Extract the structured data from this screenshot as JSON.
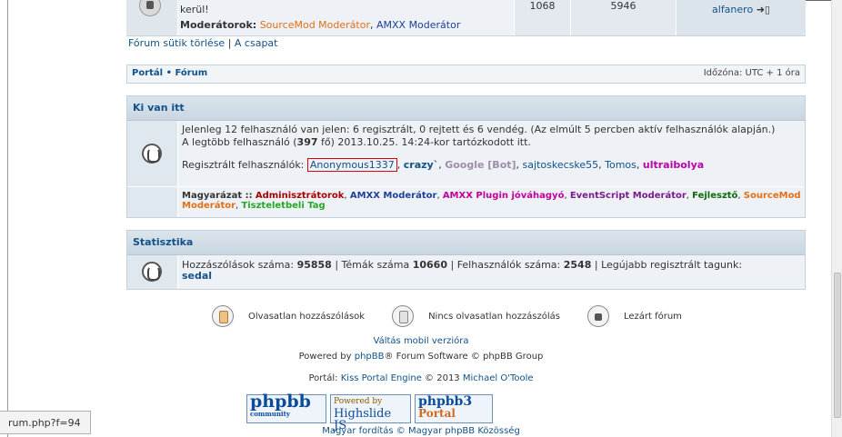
{
  "top_forum_row": {
    "description_tail": "kerül!",
    "moderators_label": "Moderátorok:",
    "moderators": [
      "SourceMod Moderátor",
      "AMXX Moderátor"
    ],
    "topics": "1068",
    "posts": "5946",
    "last_poster": "alfanero"
  },
  "small_links": {
    "delete_cookies": "Fórum sütik törlése",
    "separator": " | ",
    "team": "A csapat"
  },
  "navbar": {
    "portal": "Portál",
    "bullet": " • ",
    "forum": "Fórum",
    "timezone": "Időzóna: UTC + 1 óra"
  },
  "whos_online": {
    "title": "Ki van itt",
    "summary": "Jelenleg 12 felhasználó van jelen: 6 regisztrált, 0 rejtett és 6 vendég. (Az elmúlt 5 percben aktív felhasználók alapján.)",
    "record_prefix": "A legtöbb felhasználó (",
    "record_count": "397",
    "record_suffix": " fő) 2013.10.25. 14:24-kor tartózkodott itt.",
    "registered_label": "Regisztrált felhasználók:",
    "users": [
      "Anonymous1337",
      "crazy`",
      "Google [Bot]",
      "sajtoskecske55",
      "Tomos",
      "ultraibolya"
    ],
    "legend_label": "Magyarázat ::",
    "legend": [
      "Adminisztrátorok",
      "AMXX Moderátor",
      "AMXX Plugin jóváhagyó",
      "EventScript Moderátor",
      "Fejlesztő",
      "SourceMod Moderátor",
      "Tiszteletbeli Tag"
    ]
  },
  "statistics": {
    "title": "Statisztika",
    "posts_label": "Hozzászólások száma:",
    "posts_value": "95858",
    "topics_label": "Témák száma",
    "topics_value": "10660",
    "users_label": "Felhasználók száma:",
    "users_value": "2548",
    "newest_label": "Legújabb regisztrált tagunk:",
    "newest_user": "sedal"
  },
  "legend_icons": {
    "unread": "Olvasatlan hozzászólások",
    "no_unread": "Nincs olvasatlan hozzászólás",
    "locked": "Lezárt fórum"
  },
  "footer": {
    "mobile": "Váltás mobil verzióra",
    "powered_prefix": "Powered by ",
    "phpbb": "phpBB",
    "powered_suffix": "® Forum Software © phpBB Group",
    "portal_prefix": "Portál: ",
    "portal_link": "Kiss Portal Engine",
    "portal_suffix": " © 2013 ",
    "author": "Michael O'Toole",
    "translation": "Magyar fordítás © Magyar phpBB Közösség",
    "badge1_main": "phpbb",
    "badge1_sub": "community",
    "badge2_top": "Powered by",
    "badge2_main": "Highslide JS",
    "badge3_main": "phpbb3",
    "badge3_sub": "Portal"
  },
  "statusbar": {
    "url": "rum.php?f=94"
  }
}
